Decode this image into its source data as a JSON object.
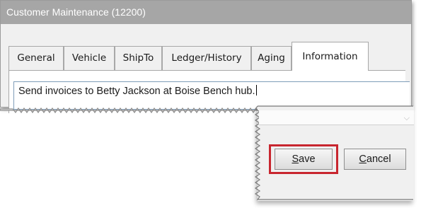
{
  "window": {
    "title": "Customer Maintenance (12200)"
  },
  "tabs": [
    {
      "label": "General"
    },
    {
      "label": "Vehicle"
    },
    {
      "label": "ShipTo"
    },
    {
      "label": "Ledger/History"
    },
    {
      "label": "Aging"
    },
    {
      "label": "Information",
      "active": true
    }
  ],
  "information": {
    "note": "Send invoices to Betty Jackson at Boise Bench hub."
  },
  "dialog": {
    "dropdown_arrow": "⌵",
    "save": {
      "prefix": "",
      "mnemonic": "S",
      "rest": "ave"
    },
    "cancel": {
      "prefix": "",
      "mnemonic": "C",
      "rest": "ancel"
    }
  },
  "colors": {
    "titlebar": "#a6a6a6",
    "highlight": "#c8262f"
  }
}
